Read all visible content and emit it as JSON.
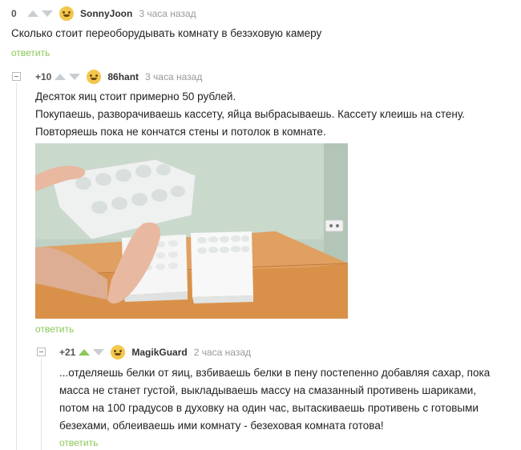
{
  "comments": [
    {
      "rating": "0",
      "username": "SonnyJoon",
      "time": "3 часа назад",
      "text": "Сколько стоит переоборудывать комнату в безэховую камеру",
      "reply": "ответить"
    },
    {
      "rating": "+10",
      "username": "86hant",
      "time": "3 часа назад",
      "lines": [
        "Десяток яиц стоит примерно 50 рублей.",
        "Покупаешь, разворачиваешь кассету, яйца выбрасываешь. Кассету клеишь на стену.",
        "Повторяешь пока не кончатся стены и потолок в комнате."
      ],
      "reply": "ответить"
    },
    {
      "rating": "+21",
      "username": "MagikGuard",
      "time": "2 часа назад",
      "lines": [
        "...отделяешь белки от яиц, взбиваешь белки в пену постепенно добавляя сахар, пока",
        "масса не станет густой, выкладываешь массу на смазанный противень шариками,",
        "потом на 100 градусов в духовку на один час, вытаскиваешь противень с готовыми",
        "безехами, облеиваешь ими комнату - безеховая комната готова!"
      ],
      "reply": "ответить"
    }
  ],
  "colors": {
    "accent": "#8ac858",
    "arrow": "#c9ced3",
    "muted": "#999999"
  }
}
